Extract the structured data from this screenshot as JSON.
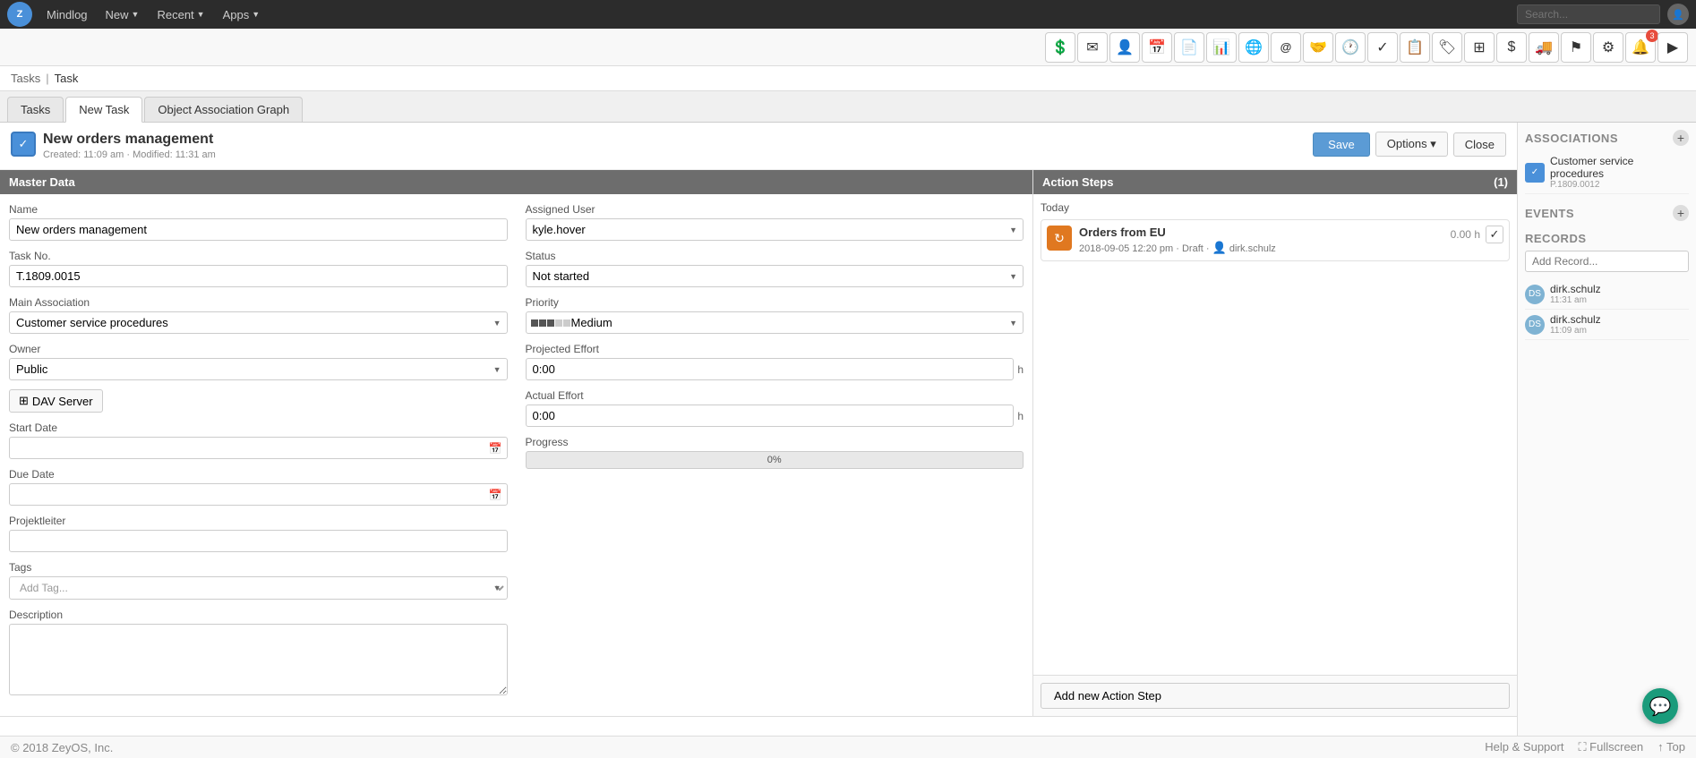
{
  "topnav": {
    "logo_text": "Z",
    "mindlog_label": "Mindlog",
    "new_label": "New",
    "recent_label": "Recent",
    "apps_label": "Apps",
    "search_placeholder": "Search..."
  },
  "breadcrumb": {
    "section": "Tasks",
    "separator": "|",
    "title": "Task"
  },
  "tabs": {
    "tasks_label": "Tasks",
    "new_task_label": "New Task",
    "object_association_label": "Object Association Graph"
  },
  "task_header": {
    "icon": "✓",
    "name": "New orders management",
    "meta": "Created: 11:09 am · Modified: 11:31 am",
    "save_label": "Save",
    "options_label": "Options ▾",
    "close_label": "Close"
  },
  "master_data": {
    "header": "Master Data",
    "name_label": "Name",
    "name_value": "New orders management",
    "task_no_label": "Task No.",
    "task_no_value": "T.1809.0015",
    "main_assoc_label": "Main Association",
    "main_assoc_value": "Customer service procedures",
    "owner_label": "Owner",
    "owner_value": "Public",
    "dav_server_label": "DAV Server",
    "start_date_label": "Start Date",
    "start_date_value": "",
    "due_date_label": "Due Date",
    "due_date_value": "",
    "projektleiter_label": "Projektleiter",
    "projektleiter_value": "",
    "tags_label": "Tags",
    "tags_placeholder": "Add Tag...",
    "description_label": "Description",
    "description_value": "",
    "assigned_user_label": "Assigned User",
    "assigned_user_value": "kyle.hover",
    "status_label": "Status",
    "status_value": "Not started",
    "priority_label": "Priority",
    "priority_value": "Medium",
    "projected_effort_label": "Projected Effort",
    "projected_effort_value": "0:00",
    "projected_effort_suffix": "h",
    "actual_effort_label": "Actual Effort",
    "actual_effort_value": "0:00",
    "actual_effort_suffix": "h",
    "progress_label": "Progress",
    "progress_value": "0%",
    "progress_percent": 0
  },
  "action_steps": {
    "header": "Action Steps",
    "count": "(1)",
    "today_label": "Today",
    "steps": [
      {
        "icon": "↻",
        "title": "Orders from EU",
        "meta": "2018-09-05 12:20 pm · Draft · dirk.schulz",
        "hours": "0.00 h"
      }
    ],
    "add_label": "Add new Action Step"
  },
  "associations": {
    "header": "ASSOCIATIONS",
    "items": [
      {
        "icon": "✓",
        "icon_color": "#4a90d9",
        "text": "Customer service procedures",
        "sub": "P.1809.0012"
      }
    ]
  },
  "events": {
    "header": "EVENTS"
  },
  "records": {
    "header": "RECORDS",
    "add_placeholder": "Add Record...",
    "entries": [
      {
        "initials": "DS",
        "name": "dirk.schulz",
        "time": "11:31 am"
      },
      {
        "initials": "DS",
        "name": "dirk.schulz",
        "time": "11:09 am"
      }
    ]
  },
  "footer": {
    "copyright": "© 2018 ZeyOS, Inc.",
    "help_label": "Help & Support",
    "fullscreen_label": "⛶ Fullscreen",
    "top_label": "↑ Top"
  },
  "toolbar_icons": [
    {
      "name": "dollar-icon",
      "symbol": "💲"
    },
    {
      "name": "mail-icon",
      "symbol": "✉"
    },
    {
      "name": "contact-icon",
      "symbol": "👤"
    },
    {
      "name": "calendar-icon",
      "symbol": "📅"
    },
    {
      "name": "file-icon",
      "symbol": "📄"
    },
    {
      "name": "chart-icon",
      "symbol": "📊"
    },
    {
      "name": "globe-icon",
      "symbol": "🌐"
    },
    {
      "name": "at-icon",
      "symbol": "@"
    },
    {
      "name": "handshake-icon",
      "symbol": "🤝"
    },
    {
      "name": "clock-icon",
      "symbol": "🕐"
    },
    {
      "name": "checkmark-icon",
      "symbol": "✓"
    },
    {
      "name": "clipboard-icon",
      "symbol": "📋"
    },
    {
      "name": "tag-icon",
      "symbol": "🏷"
    },
    {
      "name": "layers-icon",
      "symbol": "⊞"
    },
    {
      "name": "money-icon",
      "symbol": "$"
    },
    {
      "name": "truck-icon",
      "symbol": "🚚"
    },
    {
      "name": "flag-icon",
      "symbol": "⚑"
    },
    {
      "name": "settings-icon",
      "symbol": "⚙"
    },
    {
      "name": "bell-icon",
      "symbol": "🔔",
      "badge": "3"
    },
    {
      "name": "arrow-icon",
      "symbol": "▶"
    }
  ]
}
